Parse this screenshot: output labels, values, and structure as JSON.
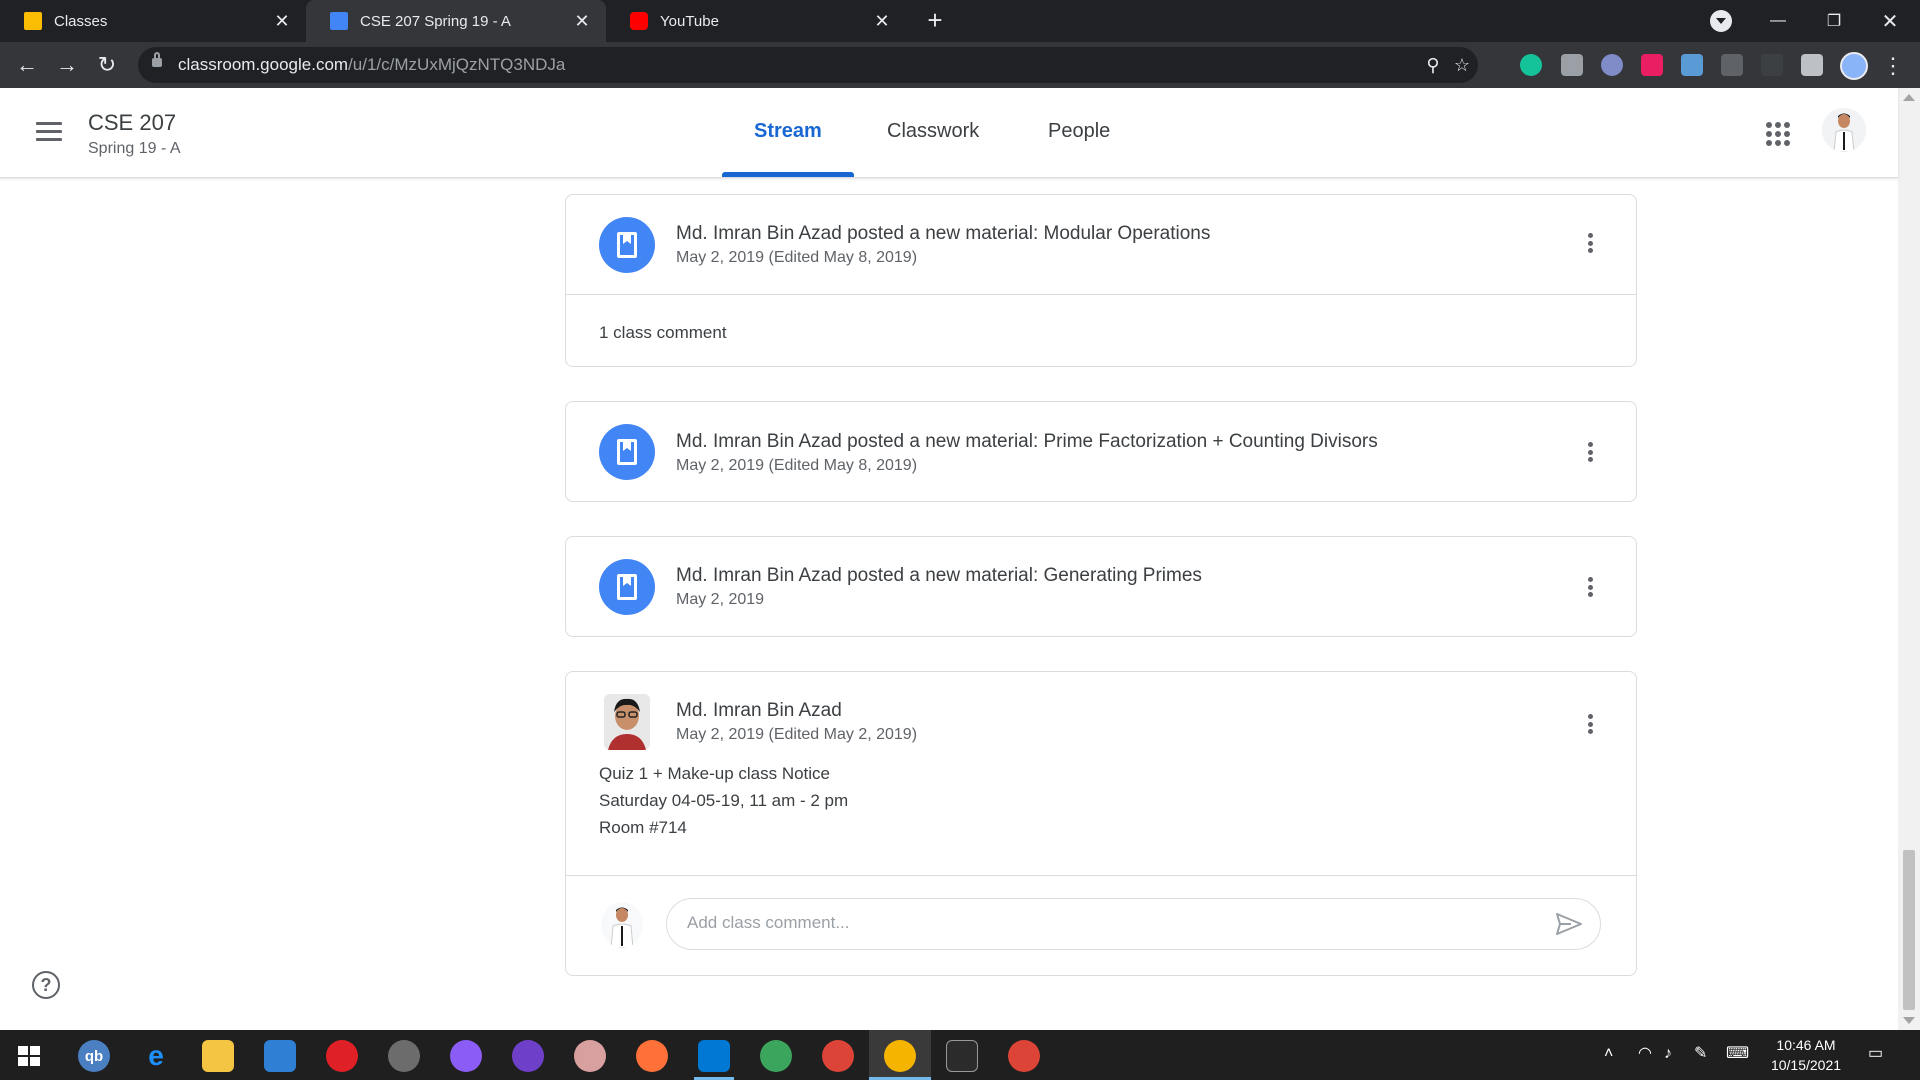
{
  "browser": {
    "tabs": [
      {
        "title": "Classes",
        "icon": "classroom-icon",
        "active": false
      },
      {
        "title": "CSE 207 Spring 19 - A",
        "icon": "classroom-icon",
        "active": true
      },
      {
        "title": "YouTube",
        "icon": "youtube-icon",
        "active": false
      }
    ],
    "url_domain": "classroom.google.com",
    "url_path": "/u/1/c/MzUxMjQzNTQ3NDJa"
  },
  "classroom": {
    "class_name": "CSE 207",
    "section": "Spring 19 - A",
    "nav_tabs": [
      "Stream",
      "Classwork",
      "People"
    ],
    "active_tab": "Stream"
  },
  "posts": [
    {
      "type": "material",
      "title": "Md. Imran Bin Azad posted a new material: Modular Operations",
      "date": "May 2, 2019 (Edited May 8, 2019)",
      "comments": "1 class comment"
    },
    {
      "type": "material",
      "title": "Md. Imran Bin Azad posted a new material: Prime Factorization + Counting Divisors",
      "date": "May 2, 2019 (Edited May 8, 2019)"
    },
    {
      "type": "material",
      "title": "Md. Imran Bin Azad posted a new material: Generating Primes",
      "date": "May 2, 2019"
    },
    {
      "type": "announcement",
      "author": "Md. Imran Bin Azad",
      "date": "May 2, 2019 (Edited May 2, 2019)",
      "body": [
        "Quiz 1 + Make-up class Notice",
        "Saturday 04-05-19, 11 am - 2 pm",
        "Room #714"
      ],
      "comment_placeholder": "Add class comment..."
    }
  ],
  "taskbar": {
    "time": "10:46 AM",
    "date": "10/15/2021"
  },
  "colors": {
    "accent": "#1967d2",
    "material_icon": "#4285f4",
    "browser_dark": "#202124",
    "taskbar": "#1f1f1f"
  }
}
